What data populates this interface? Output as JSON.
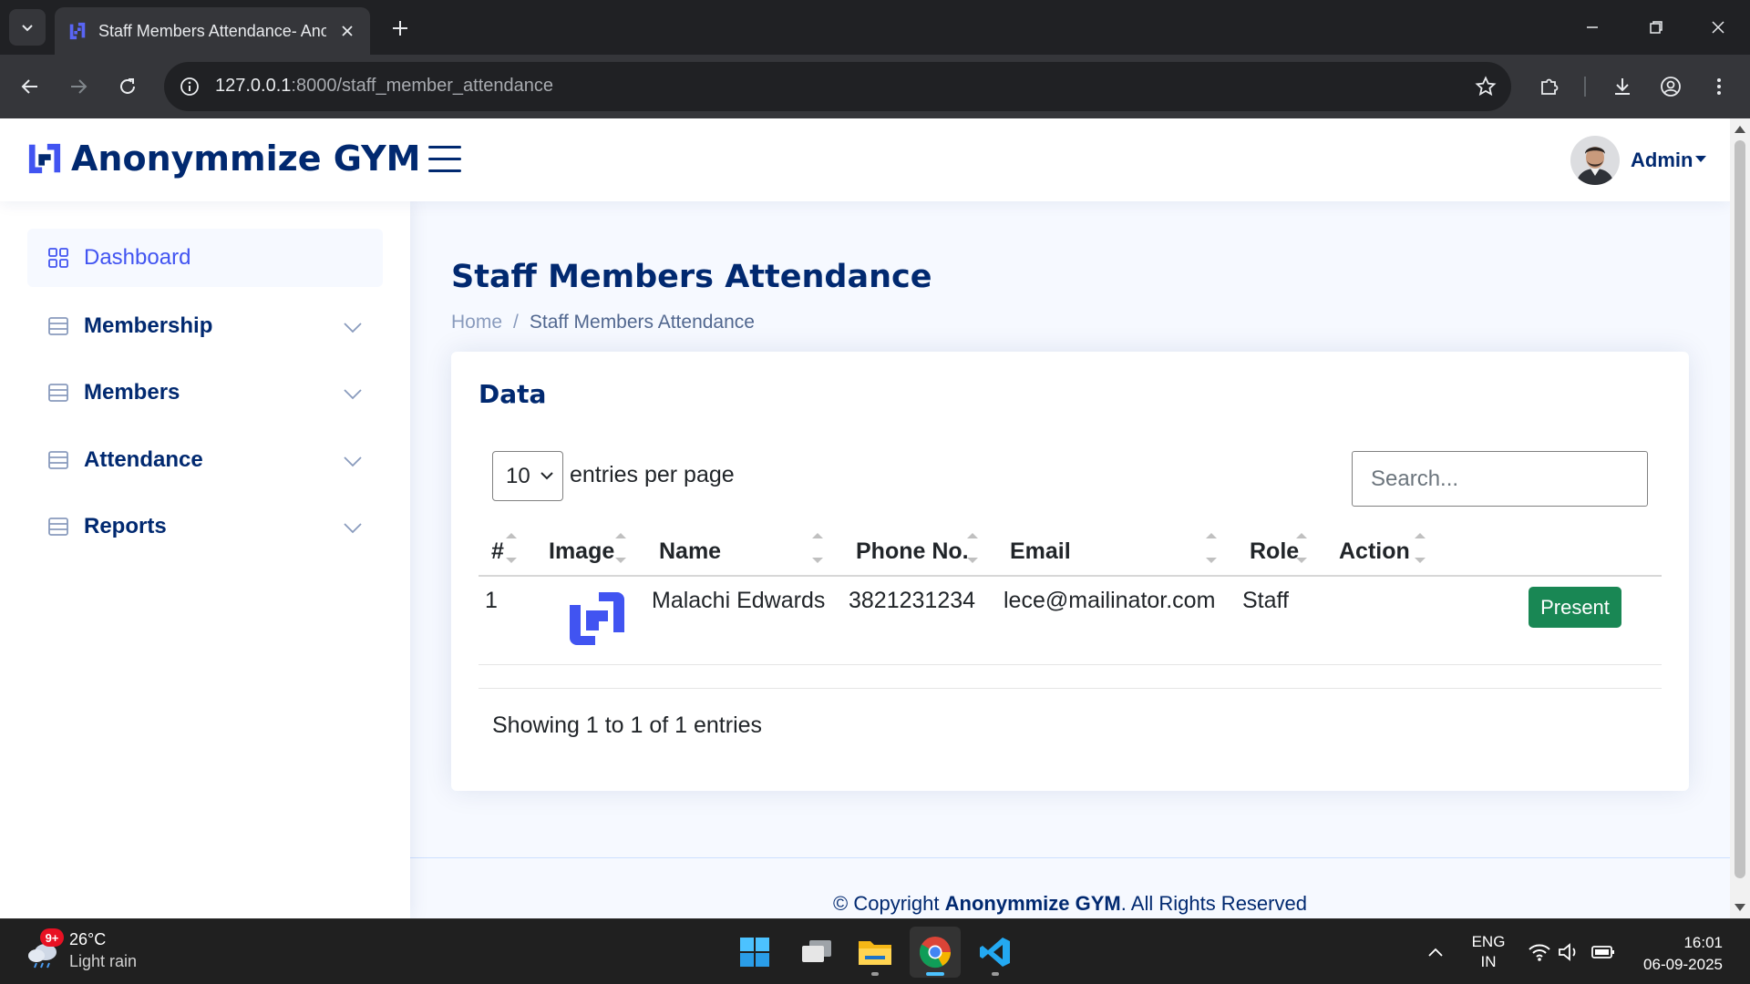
{
  "browser": {
    "tab_title": "Staff Members Attendance- Anonymmize GYM",
    "url_host": "127.0.0.1",
    "url_path": ":8000/staff_member_attendance"
  },
  "header": {
    "brand": "Anonymmize GYM",
    "user_name": "Admin"
  },
  "sidebar": {
    "items": [
      {
        "label": "Dashboard",
        "icon": "grid-icon"
      },
      {
        "label": "Membership",
        "icon": "list-icon"
      },
      {
        "label": "Members",
        "icon": "list-icon"
      },
      {
        "label": "Attendance",
        "icon": "list-icon"
      },
      {
        "label": "Reports",
        "icon": "list-icon"
      }
    ]
  },
  "main": {
    "title": "Staff Members Attendance",
    "breadcrumb": {
      "home": "Home",
      "sep": "/",
      "current": "Staff Members Attendance"
    },
    "card": {
      "title": "Data",
      "per_page_value": "10",
      "per_page_label": "entries per page",
      "search_placeholder": "Search...",
      "columns": [
        "#",
        "Image",
        "Name",
        "Phone No.",
        "Email",
        "Role",
        "Action"
      ],
      "rows": [
        {
          "num": "1",
          "name": "Malachi Edwards",
          "phone": "3821231234",
          "email": "lece@mailinator.com",
          "role": "Staff",
          "action": "Present"
        }
      ],
      "info": "Showing 1 to 1 of 1 entries"
    }
  },
  "footer": {
    "prefix": "© Copyright ",
    "brand": "Anonymmize GYM",
    "suffix": ". All Rights Reserved"
  },
  "colors": {
    "brand_dark": "#012970",
    "accent": "#4154f1",
    "present_button": "#198754"
  },
  "taskbar": {
    "weather_badge": "9+",
    "temperature": "26°C",
    "weather": "Light rain",
    "lang_line1": "ENG",
    "lang_line2": "IN",
    "time": "16:01",
    "date": "06-09-2025"
  }
}
